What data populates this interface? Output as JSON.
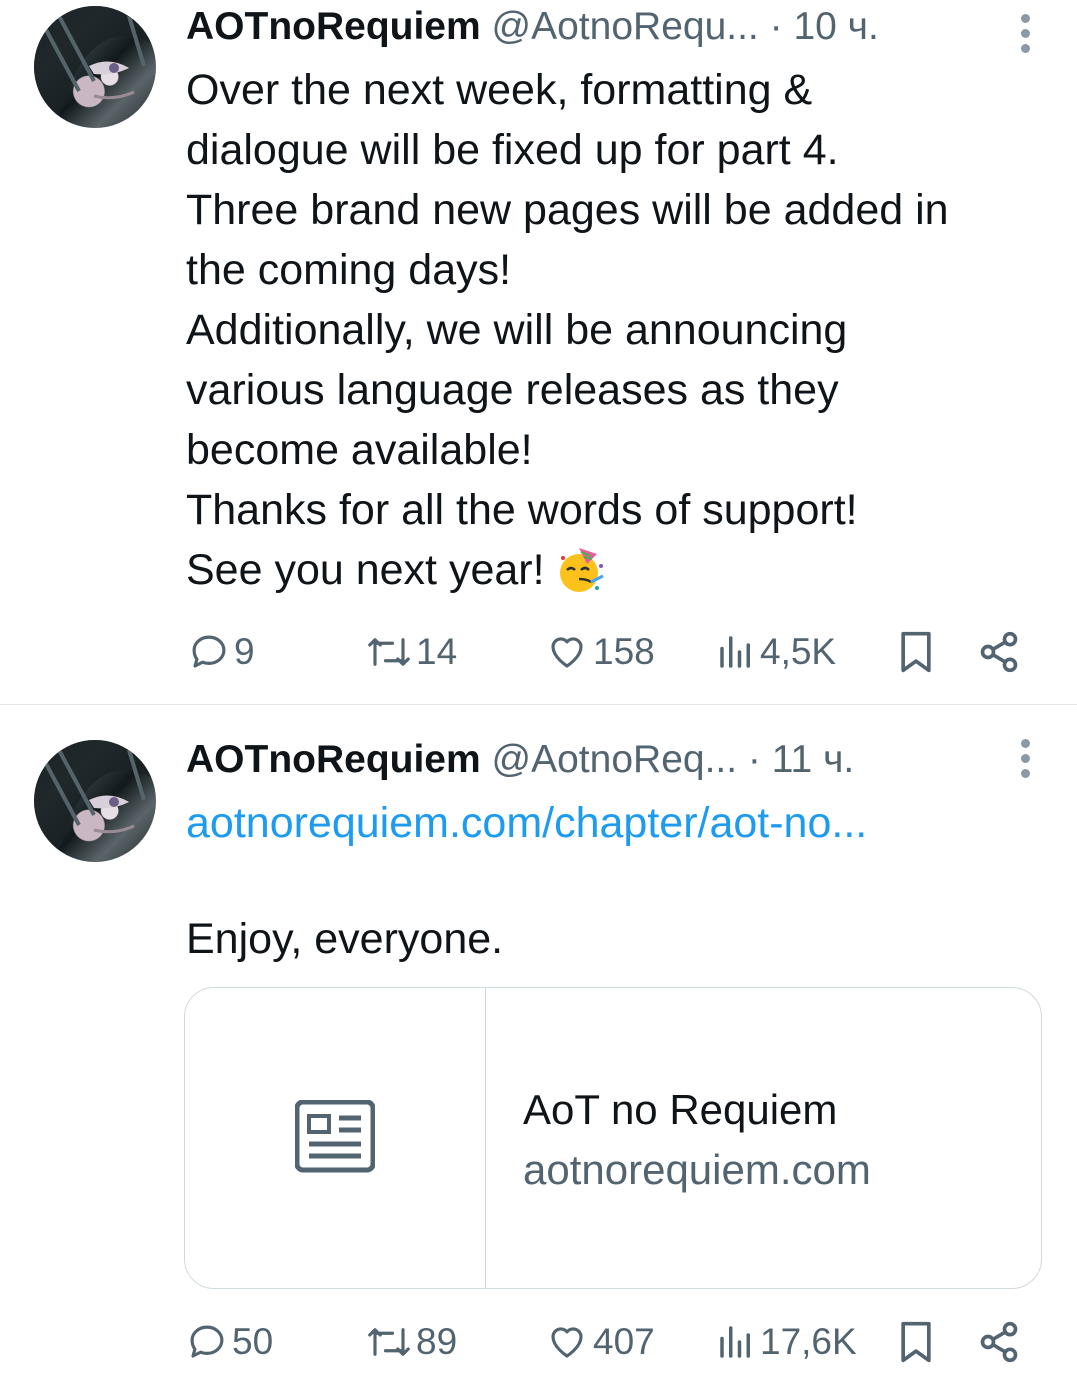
{
  "tweets": [
    {
      "author_name": "AOTnoRequiem",
      "handle": "@AotnoRequ...",
      "time": "10 ч.",
      "lines": [
        "Over the next week, formatting &",
        "dialogue will be fixed up for part 4.",
        "Three brand new pages will be added in",
        "the coming days!",
        "Additionally, we will be announcing",
        "various language releases as they",
        "become available!",
        "Thanks for all the words of support!",
        "See you next year!"
      ],
      "emoji": "partying-face-emoji",
      "replies": "9",
      "reposts": "14",
      "likes": "158",
      "views": "4,5K"
    },
    {
      "author_name": "AOTnoRequiem",
      "handle": "@AotnoReq...",
      "time": "11 ч.",
      "link": "aotnorequiem.com/chapter/aot-no...",
      "text": "Enjoy, everyone.",
      "card": {
        "title": "AoT no Requiem",
        "domain": "aotnorequiem.com"
      },
      "replies": "50",
      "reposts": "89",
      "likes": "407",
      "views": "17,6K"
    }
  ],
  "colors": {
    "text": "#0f1419",
    "secondary": "#536471",
    "link": "#1d9bf0",
    "border": "#cfd9de"
  }
}
